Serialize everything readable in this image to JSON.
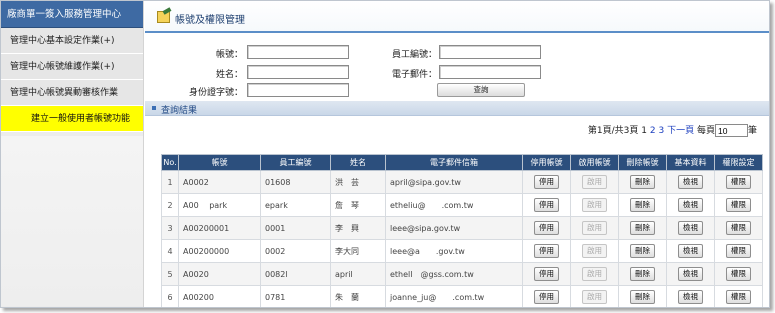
{
  "sidebar": {
    "title": "廠商單一簽入服務管理中心",
    "items": [
      {
        "label": "管理中心基本設定作業(+)"
      },
      {
        "label": "管理中心帳號維護作業(+)"
      },
      {
        "label": "管理中心帳號異動審核作業"
      },
      {
        "label": "建立一般使用者帳號功能"
      }
    ]
  },
  "header": {
    "title": "帳號及權限管理"
  },
  "search": {
    "account_label": "帳號：",
    "employee_id_label": "員工編號：",
    "name_label": "姓名：",
    "email_label": "電子郵件：",
    "id_number_label": "身份證字號：",
    "account_value": "",
    "employee_id_value": "",
    "name_value": "",
    "email_value": "",
    "id_number_value": "",
    "button_label": "查詢"
  },
  "results": {
    "title": "查詢結果"
  },
  "pager": {
    "summary": "第1頁/共3頁",
    "pages": [
      "1",
      "2",
      "3"
    ],
    "next_label": "下一頁",
    "per_page_label": "每頁",
    "per_page_value": "10",
    "unit": "筆"
  },
  "table": {
    "headers": [
      "No.",
      "帳號",
      "員工編號",
      "姓名",
      "電子郵件信箱",
      "停用帳號",
      "啟用帳號",
      "刪除帳號",
      "基本資料",
      "權限設定"
    ],
    "action_labels": {
      "disable": "停用",
      "enable": "啟用",
      "delete": "刪除",
      "view": "檢視",
      "permission": "權限"
    },
    "rows": [
      {
        "no": "1",
        "account": "A0002",
        "employee_id": "01608",
        "name": "洪　芸",
        "email": "april@sipa.gov.tw"
      },
      {
        "no": "2",
        "account": "A00　 park",
        "employee_id": "epark",
        "name": "詹　琴",
        "email": "etheliu@　　.com.tw"
      },
      {
        "no": "3",
        "account": "A00200001",
        "employee_id": "0001",
        "name": "李　興",
        "email": "leee@sipa.gov.tw"
      },
      {
        "no": "4",
        "account": "A00200000",
        "employee_id": "0002",
        "name": "李大同",
        "email": "leee@a　　.gov.tw"
      },
      {
        "no": "5",
        "account": "A0020",
        "employee_id": "0082l",
        "name": "april",
        "email": "ethell　@gss.com.tw"
      },
      {
        "no": "6",
        "account": "A00200",
        "employee_id": "0781",
        "name": "朱　蘭",
        "email": "joanne_ju@　　.com.tw"
      }
    ]
  },
  "colors": {
    "sidebar_title_bg": "#3e6aa3",
    "active_item_bg": "#ffff00",
    "table_header_bg": "#2c4f7d",
    "link": "#1c3fbf"
  }
}
